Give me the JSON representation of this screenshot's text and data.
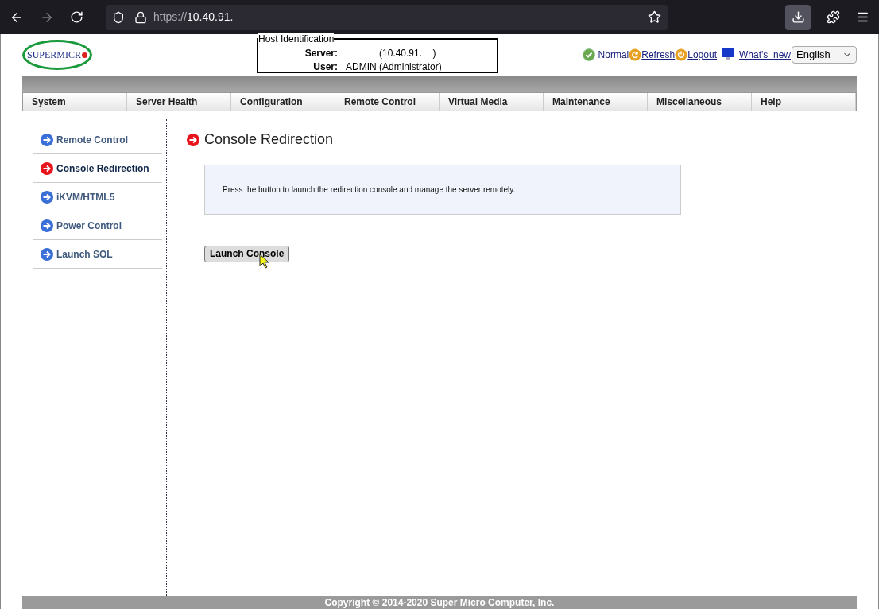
{
  "browser": {
    "url_scheme": "https://",
    "url_host": "10.40.91."
  },
  "header": {
    "logo": "SUPERMICR",
    "host_identification": {
      "legend": "Host Identification",
      "rows": [
        {
          "label": "Server:",
          "value": "",
          "detail": "(10.40.91.    )"
        },
        {
          "label": "User:",
          "value": "ADMIN",
          "detail": "(Administrator)"
        }
      ]
    },
    "status": "Normal",
    "links": [
      "Refresh",
      "Logout",
      "What's_new"
    ],
    "language": "English"
  },
  "menu": [
    "System",
    "Server Health",
    "Configuration",
    "Remote Control",
    "Virtual Media",
    "Maintenance",
    "Miscellaneous",
    "Help"
  ],
  "sidebar": {
    "items": [
      {
        "label": "Remote Control",
        "selected": false
      },
      {
        "label": "Console Redirection",
        "selected": true
      },
      {
        "label": "iKVM/HTML5",
        "selected": false
      },
      {
        "label": "Power Control",
        "selected": false
      },
      {
        "label": "Launch SOL",
        "selected": false
      }
    ]
  },
  "content": {
    "title": "Console Redirection",
    "info": "Press the button to launch the redirection console and manage the server remotely.",
    "button": "Launch Console"
  },
  "footer": "Copyright © 2014-2020 Super Micro Computer, Inc."
}
